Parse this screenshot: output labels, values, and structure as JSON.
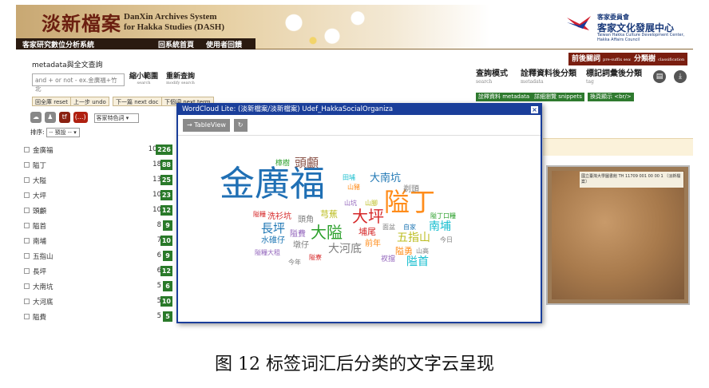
{
  "header": {
    "title": "淡新檔案",
    "subtitle_en_1": "DanXin Archives System",
    "subtitle_en_2": "for Hakka Studies (DASH)",
    "nav": [
      "客家研究數位分析系統",
      "回系統首頁",
      "使用者回饋"
    ],
    "org_small": "客家委員會",
    "org_big": "客家文化發展中心",
    "org_en": "Taiwan Hakka Culture Development Center, Hakka Affairs Council"
  },
  "search": {
    "label": "metadata與全文查詢",
    "placeholder": "and + or not - ex.金廣福+竹北",
    "narrow": "縮小範圍",
    "narrow_en": "search",
    "requery": "重新查詢",
    "requery_en": "modify search",
    "buttons": [
      "回全庫 reset",
      "上一步 undo",
      "下一篇 next doc",
      "下個詞 next term"
    ]
  },
  "right_panel": {
    "tabs": [
      {
        "label": "前後關詞",
        "sub": "pre-suffix search"
      },
      {
        "label": "分類樹",
        "sub": "classification"
      }
    ],
    "queries": [
      {
        "label": "查詢模式",
        "sub": "search"
      },
      {
        "label": "詮釋資料後分類",
        "sub": "metadata"
      },
      {
        "label": "標記詞彙後分類",
        "sub": "tag"
      }
    ],
    "green_buttons": [
      "詮釋資料 metadata",
      "詳細瀏覽 snippets",
      "換頁顯示 <br/>"
    ]
  },
  "list_header": {
    "icon_labels": [
      "☁",
      "♟",
      "tf",
      "(...)"
    ],
    "select_value": "客家特色詞",
    "sort_label": "排序:",
    "sort_value": "-- 預設 --"
  },
  "terms": [
    {
      "term": "金廣福",
      "n1": "101",
      "n2": "226"
    },
    {
      "term": "隘丁",
      "n1": "18",
      "n2": "88"
    },
    {
      "term": "大隘",
      "n1": "13",
      "n2": "25"
    },
    {
      "term": "大坪",
      "n1": "10",
      "n2": "23"
    },
    {
      "term": "頭顱",
      "n1": "10",
      "n2": "12"
    },
    {
      "term": "隘首",
      "n1": "8",
      "n2": "9"
    },
    {
      "term": "南埔",
      "n1": "7",
      "n2": "10"
    },
    {
      "term": "五指山",
      "n1": "6",
      "n2": "9"
    },
    {
      "term": "長坪",
      "n1": "6",
      "n2": "12"
    },
    {
      "term": "大南坑",
      "n1": "5",
      "n2": "6"
    },
    {
      "term": "大河底",
      "n1": "5",
      "n2": "10"
    },
    {
      "term": "隘費",
      "n1": "5",
      "n2": "5"
    }
  ],
  "popup": {
    "title": "WordCloud Lite: (淡新檔案/淡新檔案) Udef_HakkaSocialOrganiza",
    "close": "×",
    "tool_table": "→ TableView",
    "tool_refresh": "↻"
  },
  "cloud_words": [
    {
      "text": "金廣福",
      "size": 44,
      "color": "#1f6fb4"
    },
    {
      "text": "隘丁",
      "size": 32,
      "color": "#ff8c1a"
    },
    {
      "text": "大坪",
      "size": 20,
      "color": "#d62728"
    },
    {
      "text": "大隘",
      "size": 20,
      "color": "#2ca02c"
    },
    {
      "text": "頭顱",
      "size": 15,
      "color": "#8c564b"
    },
    {
      "text": "大南坑",
      "size": 13,
      "color": "#1f77b4"
    },
    {
      "text": "長坪",
      "size": 15,
      "color": "#1f77b4"
    },
    {
      "text": "南埔",
      "size": 14,
      "color": "#17becf"
    },
    {
      "text": "五指山",
      "size": 14,
      "color": "#bcbd22"
    },
    {
      "text": "大河底",
      "size": 14,
      "color": "#7f7f7f"
    },
    {
      "text": "隘首",
      "size": 14,
      "color": "#17becf"
    },
    {
      "text": "剃頭",
      "size": 10,
      "color": "#7f7f7f"
    },
    {
      "text": "樟樹",
      "size": 9,
      "color": "#2ca02c"
    },
    {
      "text": "田埔",
      "size": 8,
      "color": "#17becf"
    },
    {
      "text": "山豬",
      "size": 8,
      "color": "#ff8c1a"
    },
    {
      "text": "山腳",
      "size": 8,
      "color": "#bcbd22"
    },
    {
      "text": "山坑",
      "size": 8,
      "color": "#9467bd"
    },
    {
      "text": "隘糧",
      "size": 8,
      "color": "#d62728"
    },
    {
      "text": "洗衫坑",
      "size": 10,
      "color": "#d62728"
    },
    {
      "text": "芎蕉",
      "size": 11,
      "color": "#bcbd22"
    },
    {
      "text": "頭角",
      "size": 10,
      "color": "#7f7f7f"
    },
    {
      "text": "隘丁口糧",
      "size": 8,
      "color": "#2ca02c"
    },
    {
      "text": "埔尾",
      "size": 11,
      "color": "#d62728"
    },
    {
      "text": "面盆",
      "size": 8,
      "color": "#7f7f7f"
    },
    {
      "text": "自家",
      "size": 8,
      "color": "#1f77b4"
    },
    {
      "text": "隘費",
      "size": 10,
      "color": "#9467bd"
    },
    {
      "text": "水碓仔",
      "size": 10,
      "color": "#1f77b4"
    },
    {
      "text": "前年",
      "size": 10,
      "color": "#ff8c1a"
    },
    {
      "text": "今日",
      "size": 8,
      "color": "#7f7f7f"
    },
    {
      "text": "墩仔",
      "size": 10,
      "color": "#7f7f7f"
    },
    {
      "text": "隘糧大租",
      "size": 8,
      "color": "#9467bd"
    },
    {
      "text": "今年",
      "size": 8,
      "color": "#7f7f7f"
    },
    {
      "text": "隘寮",
      "size": 8,
      "color": "#d62728"
    },
    {
      "text": "隘勇",
      "size": 11,
      "color": "#ff8c1a"
    },
    {
      "text": "山高",
      "size": 8,
      "color": "#7f7f7f"
    },
    {
      "text": "衩擋",
      "size": 9,
      "color": "#9467bd"
    }
  ],
  "scan_label": "國立臺灣大學圖書館 TH 11709 001 00 00 1 〔淡新檔案〕",
  "caption": "图 12  标签词汇后分类的文字云呈现"
}
